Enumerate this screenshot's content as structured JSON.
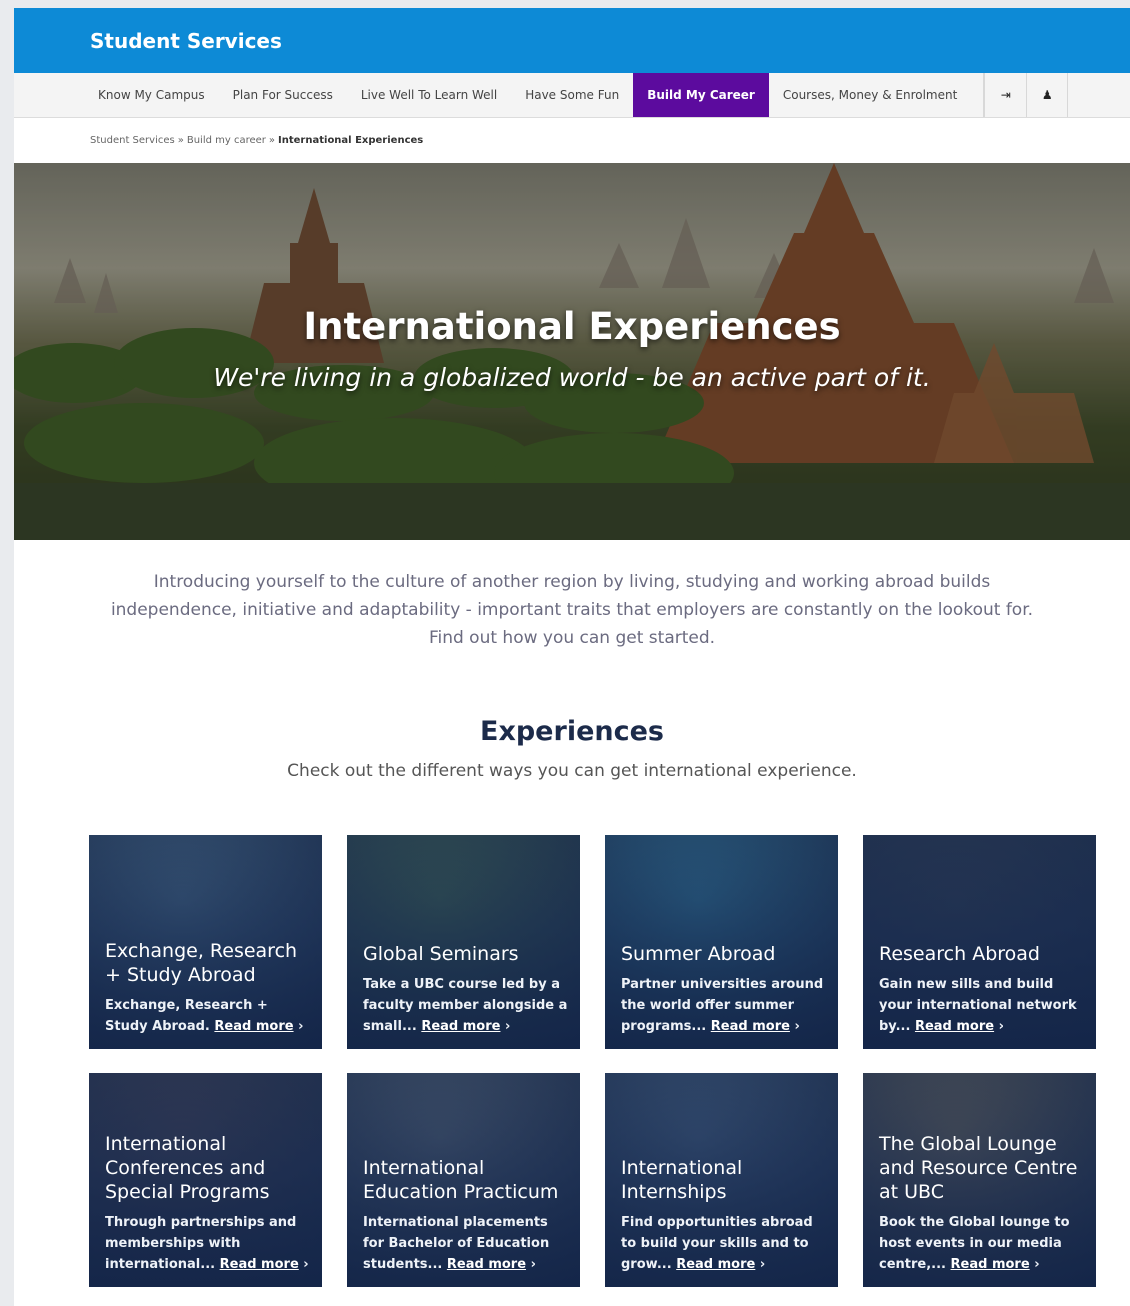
{
  "header": {
    "site_title": "Student Services"
  },
  "nav": {
    "items": [
      {
        "label": "Know My Campus",
        "active": false
      },
      {
        "label": "Plan For Success",
        "active": false
      },
      {
        "label": "Live Well To Learn Well",
        "active": false
      },
      {
        "label": "Have Some Fun",
        "active": false
      },
      {
        "label": "Build My Career",
        "active": true
      },
      {
        "label": "Courses, Money & Enrolment",
        "active": false
      }
    ],
    "icons": [
      "login-icon",
      "bell-icon"
    ],
    "icon_glyphs": [
      "⇥",
      "♟"
    ]
  },
  "breadcrumb": {
    "items": [
      "Student Services",
      "Build my career",
      "International Experiences"
    ],
    "separator": "»"
  },
  "hero": {
    "title": "International Experiences",
    "subtitle": "We're living in a globalized world - be an active part of it."
  },
  "intro": {
    "text": "Introducing yourself to the culture of another region by living, studying and working abroad builds independence, initiative and adaptability - important traits that employers are constantly on the lookout for. Find out how you can get started."
  },
  "experiences": {
    "title": "Experiences",
    "subtitle": "Check out the different ways you can get international experience.",
    "read_more": "Read more",
    "chevron": "›",
    "cards": [
      {
        "title": "Exchange, Research + Study Abroad",
        "desc": "Exchange, Research + Study Abroad.",
        "bg": "#41607e"
      },
      {
        "title": "Global Seminars",
        "desc": "Take a UBC course led by a faculty member alongside a small...",
        "bg": "#3a5a52"
      },
      {
        "title": "Summer Abroad",
        "desc": "Partner universities around the world offer summer programs...",
        "bg": "#2f6a8c"
      },
      {
        "title": "Research Abroad",
        "desc": "Gain new sills and build your international network by...",
        "bg": "#2c3a52"
      },
      {
        "title": "International Conferences and Special Programs",
        "desc": "Through partnerships and memberships with international...",
        "bg": "#3a3e54"
      },
      {
        "title": "International Education Practicum",
        "desc": "International placements for Bachelor of Education students...",
        "bg": "#4b5a6e"
      },
      {
        "title": "International Internships",
        "desc": "Find opportunities abroad to build your skills and to grow...",
        "bg": "#3f5878"
      },
      {
        "title": "The Global Lounge and Resource Centre at UBC",
        "desc": "Book the Global lounge to host events in our media centre,...",
        "bg": "#5a5a58"
      }
    ]
  },
  "colors": {
    "header_blue": "#0d8ad6",
    "nav_active_purple": "#5c0b9e",
    "heading_navy": "#1c2b4a"
  }
}
